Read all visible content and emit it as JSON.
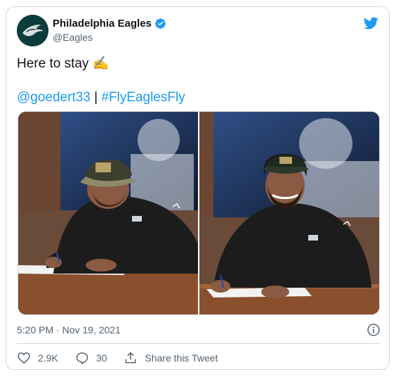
{
  "account": {
    "name": "Philadelphia Eagles",
    "handle": "@Eagles"
  },
  "tweet": {
    "text": "Here to stay",
    "emoji": "✍",
    "mention": "@goedert33",
    "separator": "|",
    "hashtag": "#FlyEaglesFly"
  },
  "timestamp": "5:20 PM · Nov 19, 2021",
  "actions": {
    "likes": "2.9K",
    "replies": "30",
    "share_label": "Share this Tweet"
  },
  "colors": {
    "link": "#1d9bf0",
    "text": "#0f1419",
    "secondary": "#536471",
    "verified": "#1d9bf0",
    "eagles_green": "#004c54"
  },
  "icons": [
    "eagles-logo-icon",
    "verified-badge-icon",
    "twitter-bird-icon",
    "info-icon",
    "heart-icon",
    "reply-icon",
    "share-icon"
  ]
}
